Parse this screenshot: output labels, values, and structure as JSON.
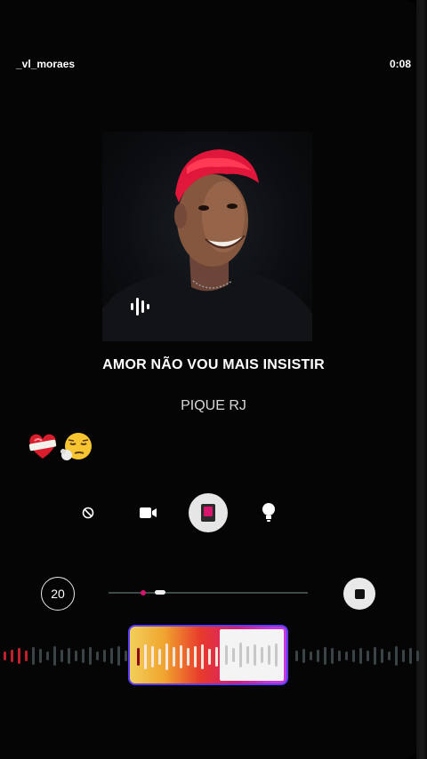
{
  "header": {
    "username": "_vl_moraes",
    "timer": "0:08"
  },
  "song": {
    "title": "AMOR NÃO VOU MAIS INSISTIR",
    "artist": "PIQUE RJ"
  },
  "stickers": [
    "heart-bandage-emoji",
    "smoking-face-emoji"
  ],
  "modes": [
    {
      "icon": "no-sign-icon",
      "active": false
    },
    {
      "icon": "video-camera-icon",
      "active": false
    },
    {
      "icon": "phone-card-icon",
      "active": true
    },
    {
      "icon": "lightbulb-icon",
      "active": false
    }
  ],
  "controls": {
    "rewind_label": "20"
  },
  "colors": {
    "accent_pink": "#d8156c",
    "selector_border": "#5a3cff",
    "background": "#000000"
  }
}
